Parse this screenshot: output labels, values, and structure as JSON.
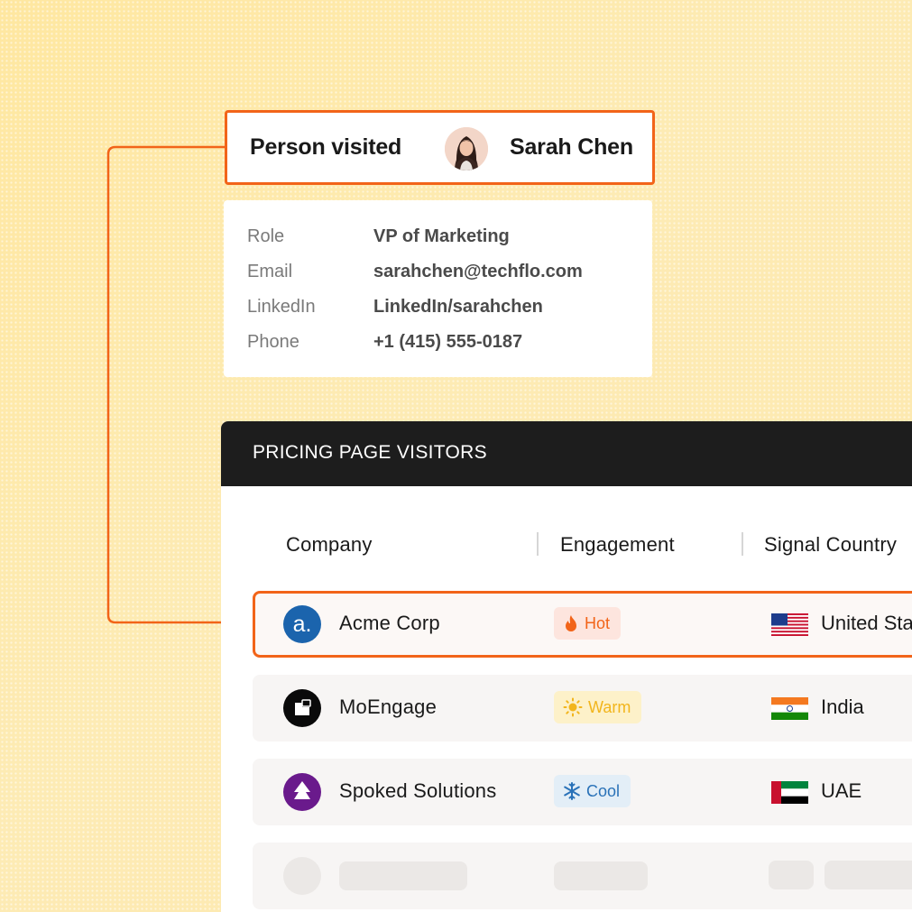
{
  "person": {
    "label": "Person visited",
    "name": "Sarah Chen",
    "details": [
      {
        "key": "Role",
        "value": "VP of Marketing"
      },
      {
        "key": "Email",
        "value": "sarahchen@techflo.com"
      },
      {
        "key": "LinkedIn",
        "value": "LinkedIn/sarahchen"
      },
      {
        "key": "Phone",
        "value": "+1 (415) 555-0187"
      }
    ]
  },
  "table": {
    "title": "PRICING PAGE VISITORS",
    "columns": [
      "Company",
      "Engagement",
      "Signal Country"
    ],
    "rows": [
      {
        "company": "Acme Corp",
        "logo_icon": "acme-logo-icon",
        "engagement": "Hot",
        "engagement_icon": "flame-icon",
        "country": "United States",
        "flag_icon": "us-flag-icon",
        "selected": true
      },
      {
        "company": "MoEngage",
        "logo_icon": "moengage-logo-icon",
        "engagement": "Warm",
        "engagement_icon": "sun-icon",
        "country": "India",
        "flag_icon": "india-flag-icon",
        "selected": false
      },
      {
        "company": "Spoked Solutions",
        "logo_icon": "spoked-logo-icon",
        "engagement": "Cool",
        "engagement_icon": "snowflake-icon",
        "country": "UAE",
        "flag_icon": "uae-flag-icon",
        "selected": false
      }
    ]
  },
  "colors": {
    "accent": "#f26419",
    "background": "#fde9a6",
    "header_bar": "#1d1d1d",
    "hot_bg": "#fde5de",
    "hot_text": "#f26419",
    "warm_bg": "#fdf1c9",
    "warm_text": "#f2b51c",
    "cool_bg": "#e3eef7",
    "cool_text": "#2a72b8"
  }
}
